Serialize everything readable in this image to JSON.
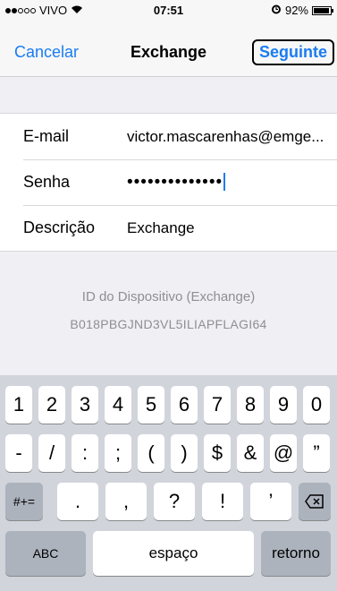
{
  "status": {
    "carrier": "VIVO",
    "time": "07:51",
    "battery": "92%"
  },
  "nav": {
    "cancel": "Cancelar",
    "title": "Exchange",
    "next": "Seguinte"
  },
  "form": {
    "rows": [
      {
        "label": "E-mail",
        "value": "victor.mascarenhas@emge..."
      },
      {
        "label": "Senha",
        "value": "••••••••••••••"
      },
      {
        "label": "Descrição",
        "value": "Exchange"
      }
    ]
  },
  "device": {
    "title": "ID do Dispositivo (Exchange)",
    "id": "B018PBGJND3VL5ILIAPFLAGI64"
  },
  "keyboard": {
    "row1": [
      "1",
      "2",
      "3",
      "4",
      "5",
      "6",
      "7",
      "8",
      "9",
      "0"
    ],
    "row2": [
      "-",
      "/",
      ":",
      ";",
      "(",
      ")",
      "$",
      "&",
      "@",
      "”"
    ],
    "row3": [
      ".",
      ",",
      "?",
      "!",
      "’"
    ],
    "shift_label": "#+=",
    "abc_label": "ABC",
    "space_label": "espaço",
    "return_label": "retorno"
  }
}
